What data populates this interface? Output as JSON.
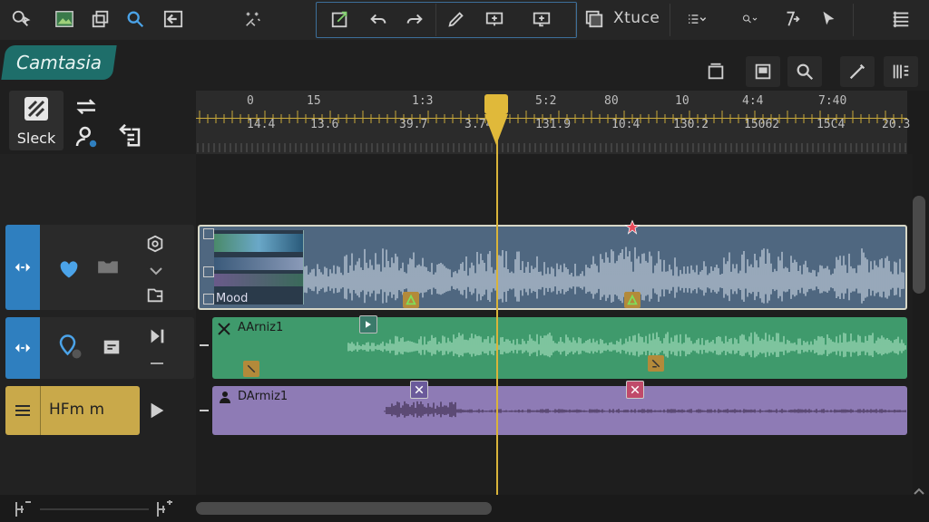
{
  "app": {
    "brand": "Camtasia"
  },
  "toolbar": {
    "extra_label": "Xtuce"
  },
  "tools": {
    "select_label": "Sleck"
  },
  "ruler": {
    "top_labels": [
      "0",
      "15",
      "1:3",
      "5:2",
      "80",
      "10",
      "4:4",
      "7:40"
    ],
    "bottom_labels": [
      "14.4",
      "13.6",
      "39.7",
      "3.74",
      "131.9",
      "10:4",
      "130.2",
      "15062",
      "15C4",
      "20.3"
    ]
  },
  "tracks": [
    {
      "name": "video-track",
      "clip_label": "Mood",
      "color": "#6f8aa8"
    },
    {
      "name": "audio-track-1",
      "clip_label": "AArniz1",
      "color": "#3f9a6c"
    },
    {
      "name": "audio-track-2",
      "clip_label": "DArmiz1",
      "color": "#8e7bb5",
      "head_label": "HFm m"
    }
  ],
  "colors": {
    "accent_yellow": "#d9b43a",
    "brand_teal": "#1e6e6a",
    "track_blue": "#2f7fbf",
    "track_yellow": "#c9a94a"
  }
}
